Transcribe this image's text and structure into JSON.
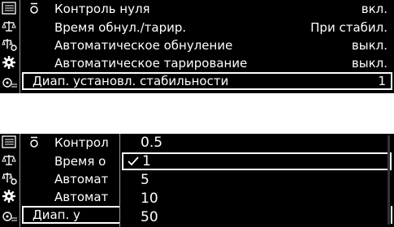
{
  "panel1": {
    "rows": [
      {
        "label": "Контроль нуля",
        "value": "вкл."
      },
      {
        "label": "Время обнул./тарир.",
        "value": "При стабил."
      },
      {
        "label": "Автоматическое обнуление",
        "value": "выкл."
      },
      {
        "label": "Автоматическое тарирование",
        "value": "выкл."
      },
      {
        "label": "Диап. установл. стабильности",
        "value": "1"
      }
    ]
  },
  "panel2": {
    "rows": [
      {
        "label": "Контрол"
      },
      {
        "label": "Время о"
      },
      {
        "label": "Автомат"
      },
      {
        "label": "Автомат"
      },
      {
        "label": "Диап. у"
      }
    ],
    "dropdown": {
      "options": [
        "0.5",
        "1",
        "5",
        "10",
        "50"
      ],
      "selected": "1"
    }
  },
  "icons": [
    "menu-icon",
    "balance-icon",
    "balance-settings-icon",
    "gear-icon",
    "user-settings-icon",
    "sub-item-icon",
    "checkmark-icon"
  ]
}
